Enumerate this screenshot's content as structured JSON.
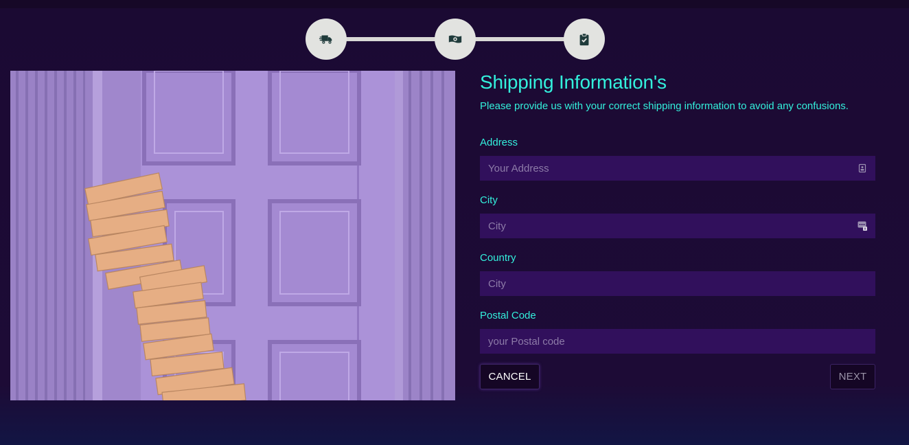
{
  "stepper": {
    "steps": [
      {
        "icon": "shipping-truck-icon",
        "state": "active"
      },
      {
        "icon": "money-bill-icon",
        "state": "pending"
      },
      {
        "icon": "clipboard-check-icon",
        "state": "pending"
      }
    ],
    "colors": {
      "circle": "#e2e3e0",
      "line": "#d9d9d6",
      "icon": "#1f3b3b"
    }
  },
  "image": {
    "subject": "stacked-packages-by-purple-door"
  },
  "form": {
    "title": "Shipping Information's",
    "subtitle": "Please provide us with your correct shipping information to avoid any confusions.",
    "fields": {
      "address": {
        "label": "Address",
        "placeholder": "Your Address",
        "value": "",
        "icon": "contact-card-icon"
      },
      "city": {
        "label": "City",
        "placeholder": "City",
        "value": "",
        "icon": "autofill-badge-icon"
      },
      "country": {
        "label": "Country",
        "placeholder": "City",
        "value": ""
      },
      "postal": {
        "label": "Postal Code",
        "placeholder": "your Postal code",
        "value": ""
      }
    },
    "buttons": {
      "cancel": "CANCEL",
      "next": "NEXT"
    }
  },
  "colors": {
    "accent": "#33f0dc",
    "input_bg": "#31105c",
    "background": "#1b0a33",
    "button_bg": "#150625"
  }
}
